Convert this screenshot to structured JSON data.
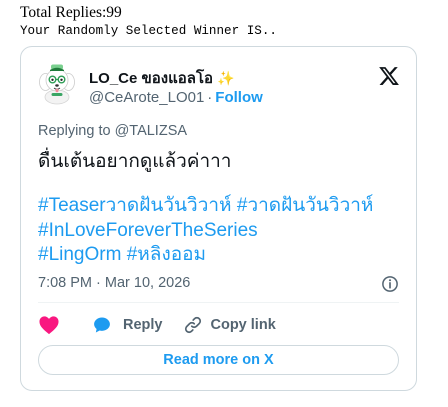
{
  "header": {
    "total_replies": "Total Replies:99",
    "winner_line": "Your Randomly Selected Winner IS.."
  },
  "tweet": {
    "author": {
      "display_name": "LO_Ce ของแอลโอ",
      "emoji": "✨",
      "handle": "@CeArote_LO01",
      "separator": "·",
      "follow_label": "Follow",
      "avatar_icon": "dog-avatar-icon"
    },
    "platform_icon": "x-logo-icon",
    "replying_to": "Replying to @TALIZSA",
    "text": "ดื่นเต้นอยากดูแล้วค่าาา",
    "hashtags": {
      "line1": [
        "#Teaserวาดฝันวันวิวาห์",
        "#วาดฝันวันวิวาห์"
      ],
      "line2": [
        "#InLoveForeverTheSeries"
      ],
      "line3": [
        "#LingOrm",
        "#หลิงออม"
      ]
    },
    "timestamp": "7:08 PM · Mar 10, 2026",
    "info_icon": "info-icon",
    "actions": {
      "like_icon": "heart-icon",
      "reply_icon": "speech-bubble-icon",
      "reply_label": "Reply",
      "copy_icon": "link-icon",
      "copy_label": "Copy link"
    },
    "read_more_label": "Read more on X"
  },
  "colors": {
    "link_blue": "#1d9bf0",
    "heart_pink": "#f91880",
    "text_dark": "#0f1419",
    "text_gray": "#536471",
    "border": "#cfd9de"
  }
}
